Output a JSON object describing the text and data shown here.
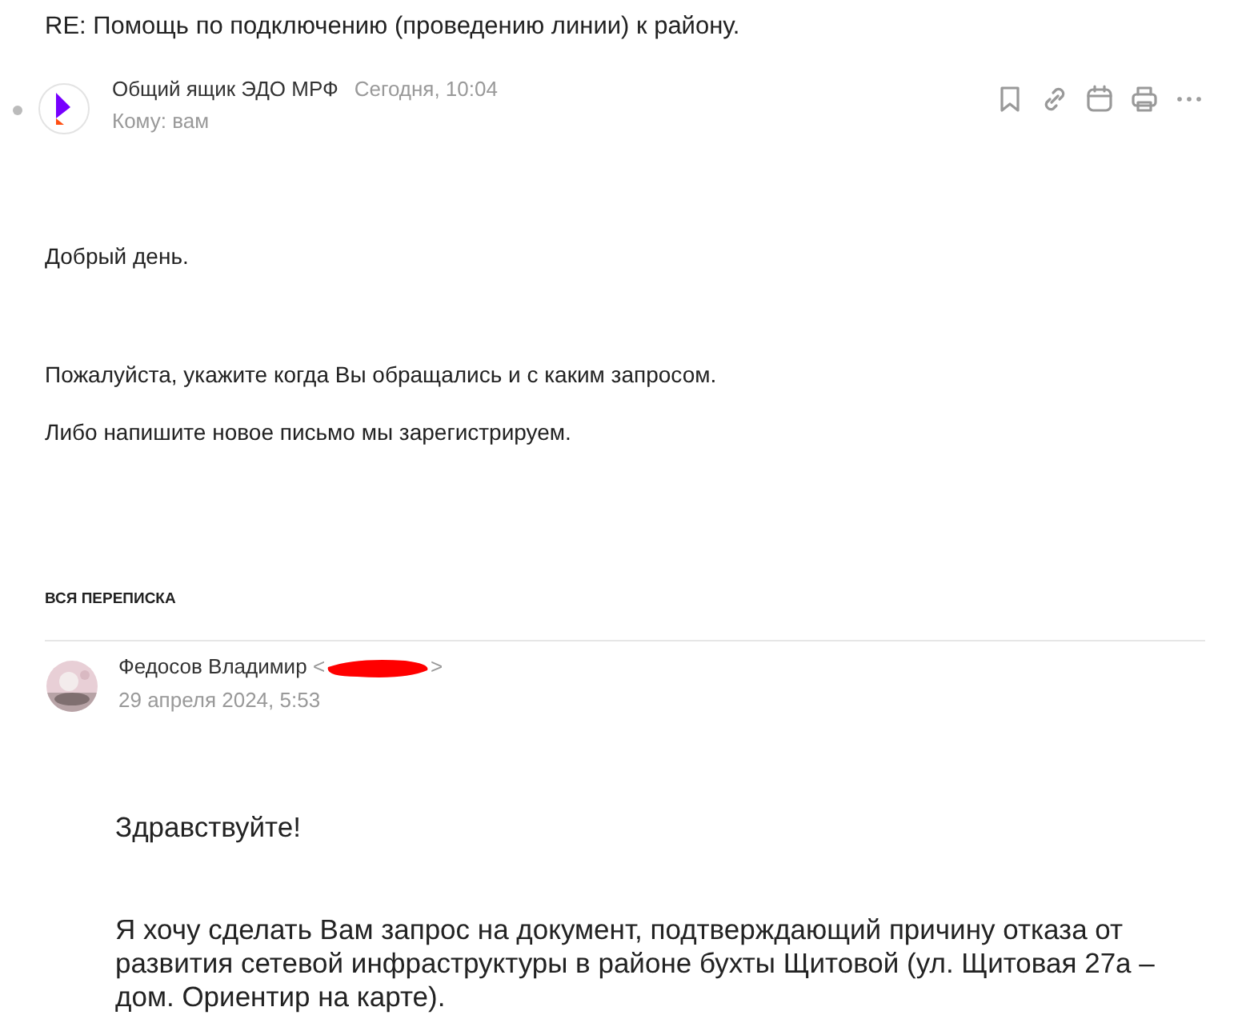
{
  "subject": "RE: Помощь по подключению (проведению линии) к району.",
  "message": {
    "sender": "Общий ящик ЭДО МРФ",
    "time": "Сегодня, 10:04",
    "recipient": "Кому: вам",
    "paragraphs": [
      "Добрый день.",
      "Пожалуйста, укажите когда Вы обращались и с каким запросом.",
      "Либо напишите новое письмо мы зарегистрируем."
    ]
  },
  "thread_heading": "ВСЯ ПЕРЕПИСКА",
  "quoted": {
    "sender": "Федосов Владимир",
    "email_open": "<",
    "email_close": ">",
    "date": "29 апреля 2024, 5:53",
    "avatar": {
      "kind": "picture"
    },
    "paragraphs": [
      "Здравствуйте!",
      "Я хочу сделать Вам запрос на документ, подтверждающий причину отказа от развития сетевой инфраструктуры в районе бухты Щитовой (ул. Щитовая 27а – дом. Ориентир на карте)."
    ]
  }
}
